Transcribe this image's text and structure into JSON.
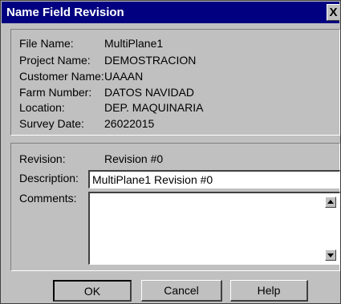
{
  "window": {
    "title": "Name Field Revision",
    "close_glyph": "X"
  },
  "info": {
    "file_name": {
      "label": "File Name:",
      "value": "MultiPlane1"
    },
    "project_name": {
      "label": "Project Name:",
      "value": "DEMOSTRACION"
    },
    "customer_name": {
      "label": "Customer Name:",
      "value": "UAAAN"
    },
    "farm_number": {
      "label": "Farm Number:",
      "value": "DATOS NAVIDAD"
    },
    "location": {
      "label": "Location:",
      "value": "DEP. MAQUINARIA"
    },
    "survey_date": {
      "label": "Survey Date:",
      "value": "26022015"
    }
  },
  "revision": {
    "label": "Revision:",
    "value": "Revision #0",
    "description_label": "Description:",
    "description_value": "MultiPlane1 Revision #0",
    "comments_label": "Comments:",
    "comments_value": ""
  },
  "buttons": {
    "ok": "OK",
    "cancel": "Cancel",
    "help": "Help"
  },
  "icons": {
    "close": "close-icon",
    "scroll_up": "arrow-up-icon",
    "scroll_down": "arrow-down-icon"
  }
}
